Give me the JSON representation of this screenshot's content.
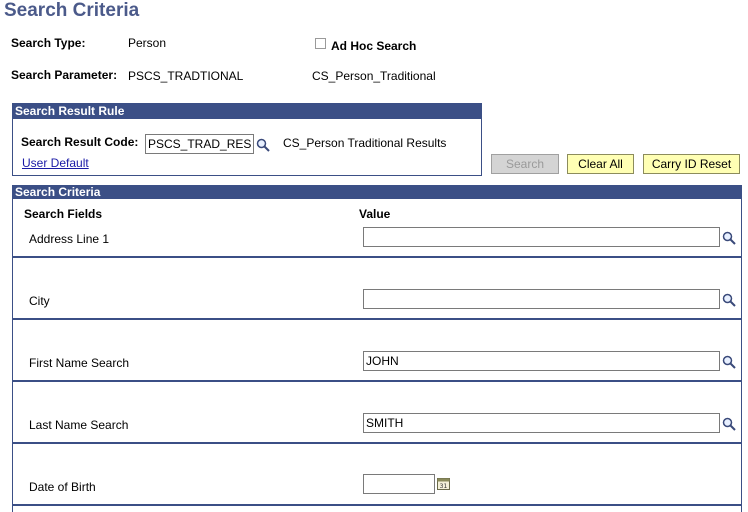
{
  "page_title": "Search Criteria",
  "search_type": {
    "label": "Search Type:",
    "value": "Person"
  },
  "ad_hoc": {
    "label": "Ad Hoc Search",
    "checked": false
  },
  "search_parameter": {
    "label": "Search Parameter:",
    "value": "PSCS_TRADTIONAL",
    "description": "CS_Person_Traditional"
  },
  "result_rule": {
    "header": "Search Result Rule",
    "code_label": "Search Result Code:",
    "code_value": "PSCS_TRAD_RES",
    "code_description": "CS_Person Traditional Results",
    "user_default_link": "User Default"
  },
  "buttons": {
    "search": "Search",
    "clear_all": "Clear All",
    "carry_id_reset": "Carry ID Reset"
  },
  "criteria": {
    "header": "Search Criteria",
    "col_fields": "Search Fields",
    "col_value": "Value",
    "fields": [
      {
        "label": "Address Line 1",
        "value": ""
      },
      {
        "label": "City",
        "value": ""
      },
      {
        "label": "First Name Search",
        "value": "JOHN"
      },
      {
        "label": "Last Name Search",
        "value": "SMITH"
      },
      {
        "label": "Date of Birth",
        "value": ""
      }
    ]
  },
  "icons": {
    "lookup": "magnifier-icon",
    "calendar": "calendar-icon"
  },
  "colors": {
    "header_bg": "#3b4f86",
    "button_bg": "#ffffb4",
    "title": "#4b5a8a",
    "link": "#1a1aa6"
  }
}
